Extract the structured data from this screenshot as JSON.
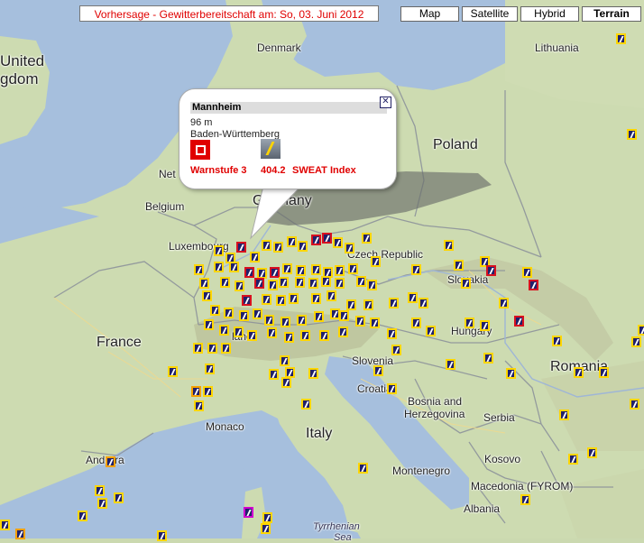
{
  "header": {
    "forecast_title": "Vorhersage - Gewitterbereitschaft am: So, 03. Juni 2012"
  },
  "map_types": [
    {
      "label": "Map",
      "active": false
    },
    {
      "label": "Satellite",
      "active": false
    },
    {
      "label": "Hybrid",
      "active": false
    },
    {
      "label": "Terrain",
      "active": true
    }
  ],
  "labels": {
    "united": "United",
    "kingdom": "gdom",
    "denmark": "Denmark",
    "lithuania": "Lithuania",
    "poland": "Poland",
    "netherlands": "Net",
    "belgium": "Belgium",
    "germany": "Germany",
    "luxembourg": "Luxembourg",
    "czech": "Czech Republic",
    "slovakia": "Slovakia",
    "france": "France",
    "hungary": "Hungary",
    "romania": "Romania",
    "switzerland": "land",
    "slovenia": "Slovenia",
    "croatia": "Croatia",
    "bosnia1": "Bosnia and",
    "bosnia2": "Herzegovina",
    "serbia": "Serbia",
    "monaco": "Monaco",
    "italy": "Italy",
    "andorra": "Andorra",
    "montenegro": "Montenegro",
    "kosovo": "Kosovo",
    "macedonia": "Macedonia (FYROM)",
    "albania": "Albania",
    "tyrrhenian": "Tyrrhenian",
    "sea": "Sea"
  },
  "infowindow": {
    "place": "Mannheim",
    "elevation": "96 m",
    "region": "Baden-Württemberg",
    "warn_label": "Warnstufe 3",
    "sweat_value": "404.2",
    "sweat_label": "SWEAT Index",
    "close_glyph": "✕"
  },
  "colors": {
    "warn_red": "#e00000",
    "marker_fill": "#20206a",
    "marker_yellow": "#ffd600",
    "marker_red": "#d81020"
  }
}
